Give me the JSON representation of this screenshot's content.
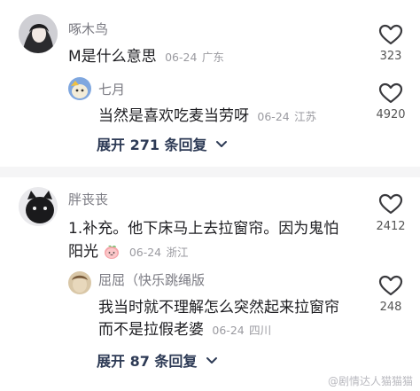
{
  "comments": [
    {
      "user": "啄木鸟",
      "text": "M是什么意思",
      "date": "06-24",
      "location": "广东",
      "likes": "323",
      "reply": {
        "user": "七月",
        "text": "当然是喜欢吃麦当劳呀",
        "date": "06-24",
        "location": "江苏",
        "likes": "4920"
      },
      "expand_label": "展开 271 条回复"
    },
    {
      "user": "胖丧丧",
      "text_line1": "1.补充。他下床马上去拉窗帘。因为鬼怕",
      "text_line2": "阳光",
      "date": "06-24",
      "location": "浙江",
      "likes": "2412",
      "reply": {
        "user": "屈屈（快乐跳绳版",
        "text_line1": "我当时就不理解怎么突然起来拉窗帘",
        "text_line2": "而不是拉假老婆",
        "date": "06-24",
        "location": "四川",
        "likes": "248"
      },
      "expand_label": "展开 87 条回复"
    }
  ],
  "watermark": "@剧情达人猫猫猫",
  "colors": {
    "accent_expand": "#2d3a55",
    "meta": "#9a9aa0",
    "name": "#7a7a82"
  },
  "icons": [
    "heart-outline-icon",
    "chevron-down-icon",
    "peach-emoji-icon"
  ]
}
